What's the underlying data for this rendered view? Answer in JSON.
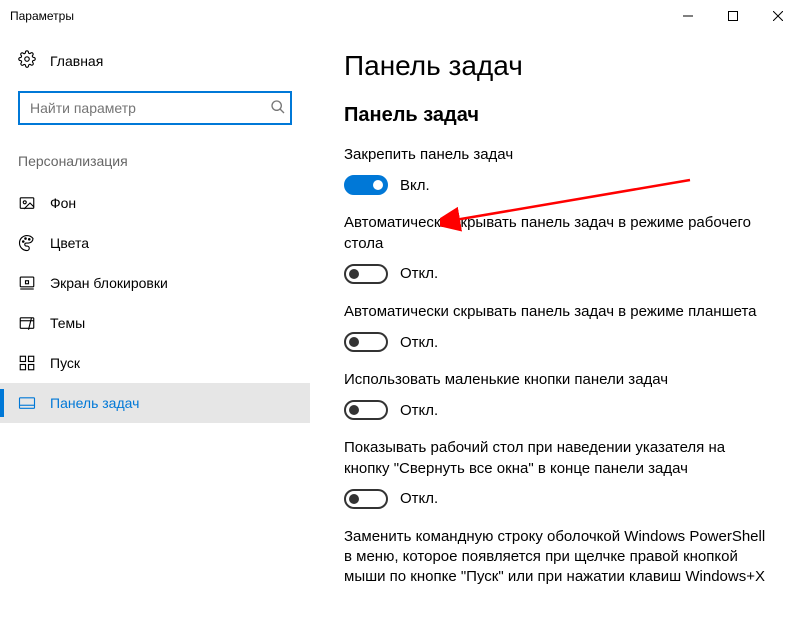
{
  "window": {
    "title": "Параметры"
  },
  "sidebar": {
    "home": "Главная",
    "search_placeholder": "Найти параметр",
    "section": "Персонализация",
    "items": [
      {
        "label": "Фон"
      },
      {
        "label": "Цвета"
      },
      {
        "label": "Экран блокировки"
      },
      {
        "label": "Темы"
      },
      {
        "label": "Пуск"
      },
      {
        "label": "Панель задач"
      }
    ]
  },
  "content": {
    "title": "Панель задач",
    "subtitle": "Панель задач",
    "on": "Вкл.",
    "off": "Откл.",
    "settings": [
      {
        "label": "Закрепить панель задач",
        "state": true
      },
      {
        "label": "Автоматически скрывать панель задач в режиме рабочего стола",
        "state": false
      },
      {
        "label": "Автоматически скрывать панель задач в режиме планшета",
        "state": false
      },
      {
        "label": "Использовать маленькие кнопки панели задач",
        "state": false
      },
      {
        "label": "Показывать рабочий стол при наведении указателя на кнопку \"Свернуть все окна\" в конце панели задач",
        "state": false
      },
      {
        "label": "Заменить командную строку оболочкой Windows PowerShell в меню, которое появляется при щелчке правой кнопкой мыши по кнопке \"Пуск\" или при нажатии клавиш Windows+X",
        "state": false
      }
    ]
  }
}
